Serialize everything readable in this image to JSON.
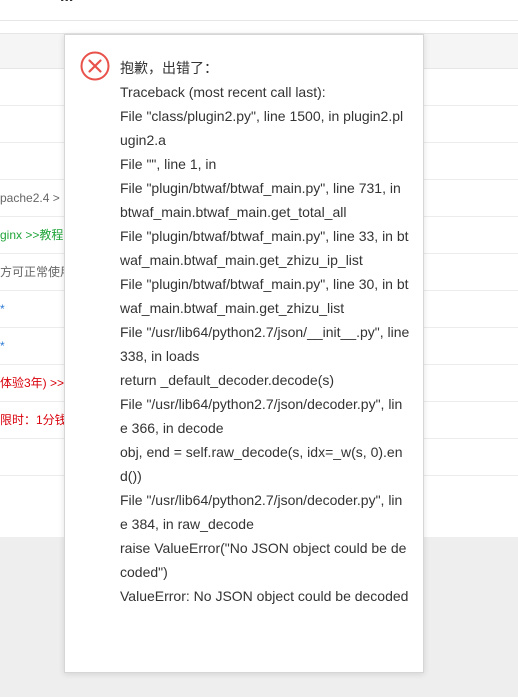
{
  "background": {
    "header_fragment": "...",
    "rows": [
      {
        "text": "",
        "color": "gray"
      },
      {
        "text": "",
        "color": "gray"
      },
      {
        "text": "",
        "color": "gray"
      },
      {
        "text": "pache2.4 >",
        "color": "gray"
      },
      {
        "text": "ginx >>教程",
        "color": "green"
      },
      {
        "text": "方可正常使用",
        "color": "gray"
      },
      {
        "text": "*",
        "color": "blue"
      },
      {
        "text": "*",
        "color": "blue"
      },
      {
        "text": "体验3年) >>",
        "color": "red"
      },
      {
        "text": "限时：1分钱",
        "color": "red"
      },
      {
        "text": "",
        "color": "gray"
      }
    ]
  },
  "dialog": {
    "icon": "error-x-circle-icon",
    "icon_color": "#e8524a",
    "lines": [
      "抱歉，出错了：",
      "Traceback (most recent call last):",
      "File \"class/plugin2.py\", line 1500, in plugin2.plugin2.a",
      "File \"\", line 1, in",
      "File \"plugin/btwaf/btwaf_main.py\", line 731, in btwaf_main.btwaf_main.get_total_all",
      "File \"plugin/btwaf/btwaf_main.py\", line 33, in btwaf_main.btwaf_main.get_zhizu_ip_list",
      "File \"plugin/btwaf/btwaf_main.py\", line 30, in btwaf_main.btwaf_main.get_zhizu_list",
      "File \"/usr/lib64/python2.7/json/__init__.py\", line 338, in loads",
      "return _default_decoder.decode(s)",
      "File \"/usr/lib64/python2.7/json/decoder.py\", line 366, in decode",
      "obj, end = self.raw_decode(s, idx=_w(s, 0).end())",
      "File \"/usr/lib64/python2.7/json/decoder.py\", line 384, in raw_decode",
      "raise ValueError(\"No JSON object could be decoded\")",
      "ValueError: No JSON object could be decoded"
    ]
  }
}
